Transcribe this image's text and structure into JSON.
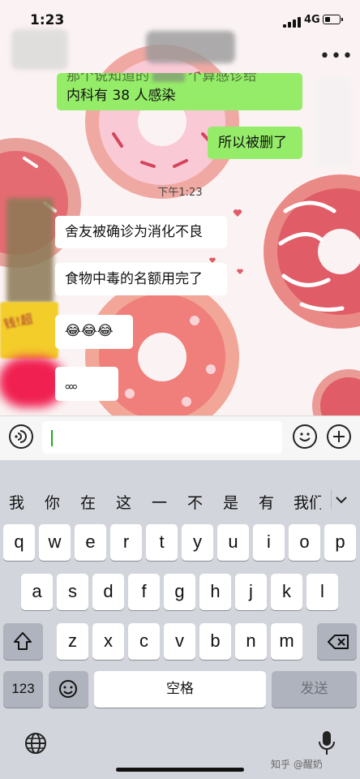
{
  "status_bar": {
    "time": "1:23",
    "network": "4G"
  },
  "messages": {
    "sent_1": {
      "line1": "那个说知道的",
      "line2": "内科有 38 人感染",
      "line1_tail": "个算感诊给"
    },
    "sent_2": "所以被删了",
    "timestamp": "下午1:23",
    "recv_1": "舍友被确诊为消化不良",
    "recv_2": "食物中毒的名额用完了",
    "recv_3": "😂😂😂",
    "recv_4": "。。。"
  },
  "keyboard": {
    "candidates": [
      "我",
      "你",
      "在",
      "这",
      "一",
      "不",
      "是",
      "有",
      "我们"
    ],
    "row1": [
      "q",
      "w",
      "e",
      "r",
      "t",
      "y",
      "u",
      "i",
      "o",
      "p"
    ],
    "row2": [
      "a",
      "s",
      "d",
      "f",
      "g",
      "h",
      "j",
      "k",
      "l"
    ],
    "row3": [
      "z",
      "x",
      "c",
      "v",
      "b",
      "n",
      "m"
    ],
    "numbers_key": "123",
    "space_key": "空格",
    "send_key": "发送"
  },
  "watermark": "知乎 @醒奶",
  "colors": {
    "sent_bubble": "#95ec69",
    "caret": "#1aad19",
    "keyboard_bg": "#d2d5dc"
  }
}
